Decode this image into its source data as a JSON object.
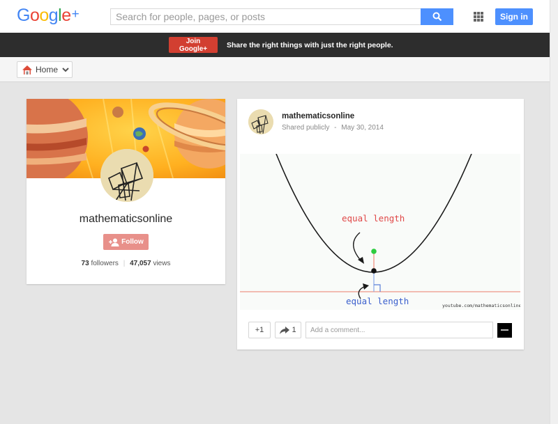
{
  "logo": {
    "letters": [
      "G",
      "o",
      "o",
      "g",
      "l",
      "e",
      "+"
    ],
    "colors": [
      "#4285f4",
      "#ea4335",
      "#fbbc05",
      "#4285f4",
      "#34a853",
      "#ea4335",
      "#4285f4"
    ]
  },
  "search": {
    "placeholder": "Search for people, pages, or posts"
  },
  "topbar": {
    "signin_label": "Sign in"
  },
  "promo": {
    "join_label": "Join Google+",
    "message": "Share the right things with just the right people."
  },
  "nav": {
    "home_label": "Home"
  },
  "profile": {
    "name": "mathematicsonline",
    "follow_label": "Follow",
    "followers_count": "73",
    "followers_label": "followers",
    "views_count": "47,057",
    "views_label": "views"
  },
  "post": {
    "author": "mathematicsonline",
    "visibility": "Shared publicly",
    "separator": "-",
    "date": "May 30, 2014",
    "media": {
      "label_top": "equal length",
      "label_bottom": "equal length",
      "watermark": "youtube.com/mathematicsonline"
    },
    "plusone_label": "+1",
    "share_count": "1",
    "comment_placeholder": "Add a comment..."
  },
  "colors": {
    "accent_blue": "#4d90fe",
    "join_red": "#d23f31",
    "follow_pink": "#e8908a",
    "label_red": "#e04848",
    "label_blue": "#3a5fcd"
  }
}
